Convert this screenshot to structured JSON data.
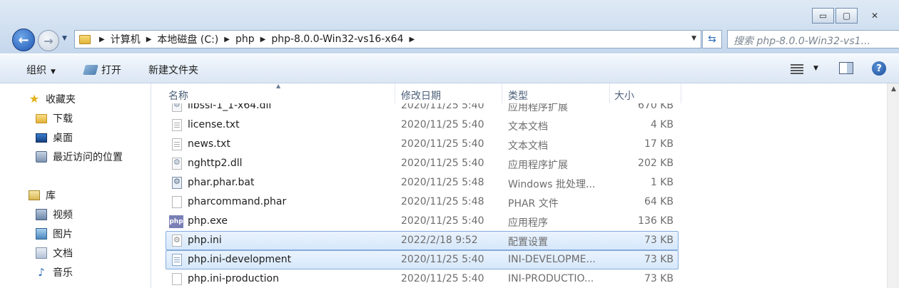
{
  "window": {
    "minimize": "▭",
    "maximize": "▢",
    "close": "✕"
  },
  "address": {
    "parts": [
      "计算机",
      "本地磁盘 (C:)",
      "php",
      "php-8.0.0-Win32-vs16-x64"
    ]
  },
  "search": {
    "placeholder": "搜索 php-8.0.0-Win32-vs1..."
  },
  "toolbar": {
    "organize": "组织",
    "open": "打开",
    "new_folder": "新建文件夹"
  },
  "nav": {
    "favorites_title": "收藏夹",
    "favorites": [
      "下载",
      "桌面",
      "最近访问的位置"
    ],
    "libraries_title": "库",
    "libraries": [
      "视频",
      "图片",
      "文档",
      "音乐"
    ]
  },
  "columns": {
    "name": "名称",
    "date": "修改日期",
    "type": "类型",
    "size": "大小"
  },
  "files": [
    {
      "name": "libssl-1_1-x64.dll",
      "date": "2020/11/25 5:40",
      "type": "应用程序扩展",
      "size": "670 KB",
      "icon": "dll-icon"
    },
    {
      "name": "license.txt",
      "date": "2020/11/25 5:40",
      "type": "文本文档",
      "size": "4 KB",
      "icon": "txt-icon"
    },
    {
      "name": "news.txt",
      "date": "2020/11/25 5:40",
      "type": "文本文档",
      "size": "17 KB",
      "icon": "txt-icon"
    },
    {
      "name": "nghttp2.dll",
      "date": "2020/11/25 5:40",
      "type": "应用程序扩展",
      "size": "202 KB",
      "icon": "dll-icon"
    },
    {
      "name": "phar.phar.bat",
      "date": "2020/11/25 5:48",
      "type": "Windows 批处理...",
      "size": "1 KB",
      "icon": "bat-icon"
    },
    {
      "name": "pharcommand.phar",
      "date": "2020/11/25 5:48",
      "type": "PHAR 文件",
      "size": "64 KB",
      "icon": "file-icon"
    },
    {
      "name": "php.exe",
      "date": "2020/11/25 5:40",
      "type": "应用程序",
      "size": "136 KB",
      "icon": "php-exe-icon"
    },
    {
      "name": "php.ini",
      "date": "2022/2/18 9:52",
      "type": "配置设置",
      "size": "73 KB",
      "icon": "ini-icon"
    },
    {
      "name": "php.ini-development",
      "date": "2020/11/25 5:40",
      "type": "INI-DEVELOPME...",
      "size": "73 KB",
      "icon": "dev-icon"
    },
    {
      "name": "php.ini-production",
      "date": "2020/11/25 5:40",
      "type": "INI-PRODUCTIO...",
      "size": "73 KB",
      "icon": "file-icon"
    }
  ],
  "exe_icon_text": "php"
}
